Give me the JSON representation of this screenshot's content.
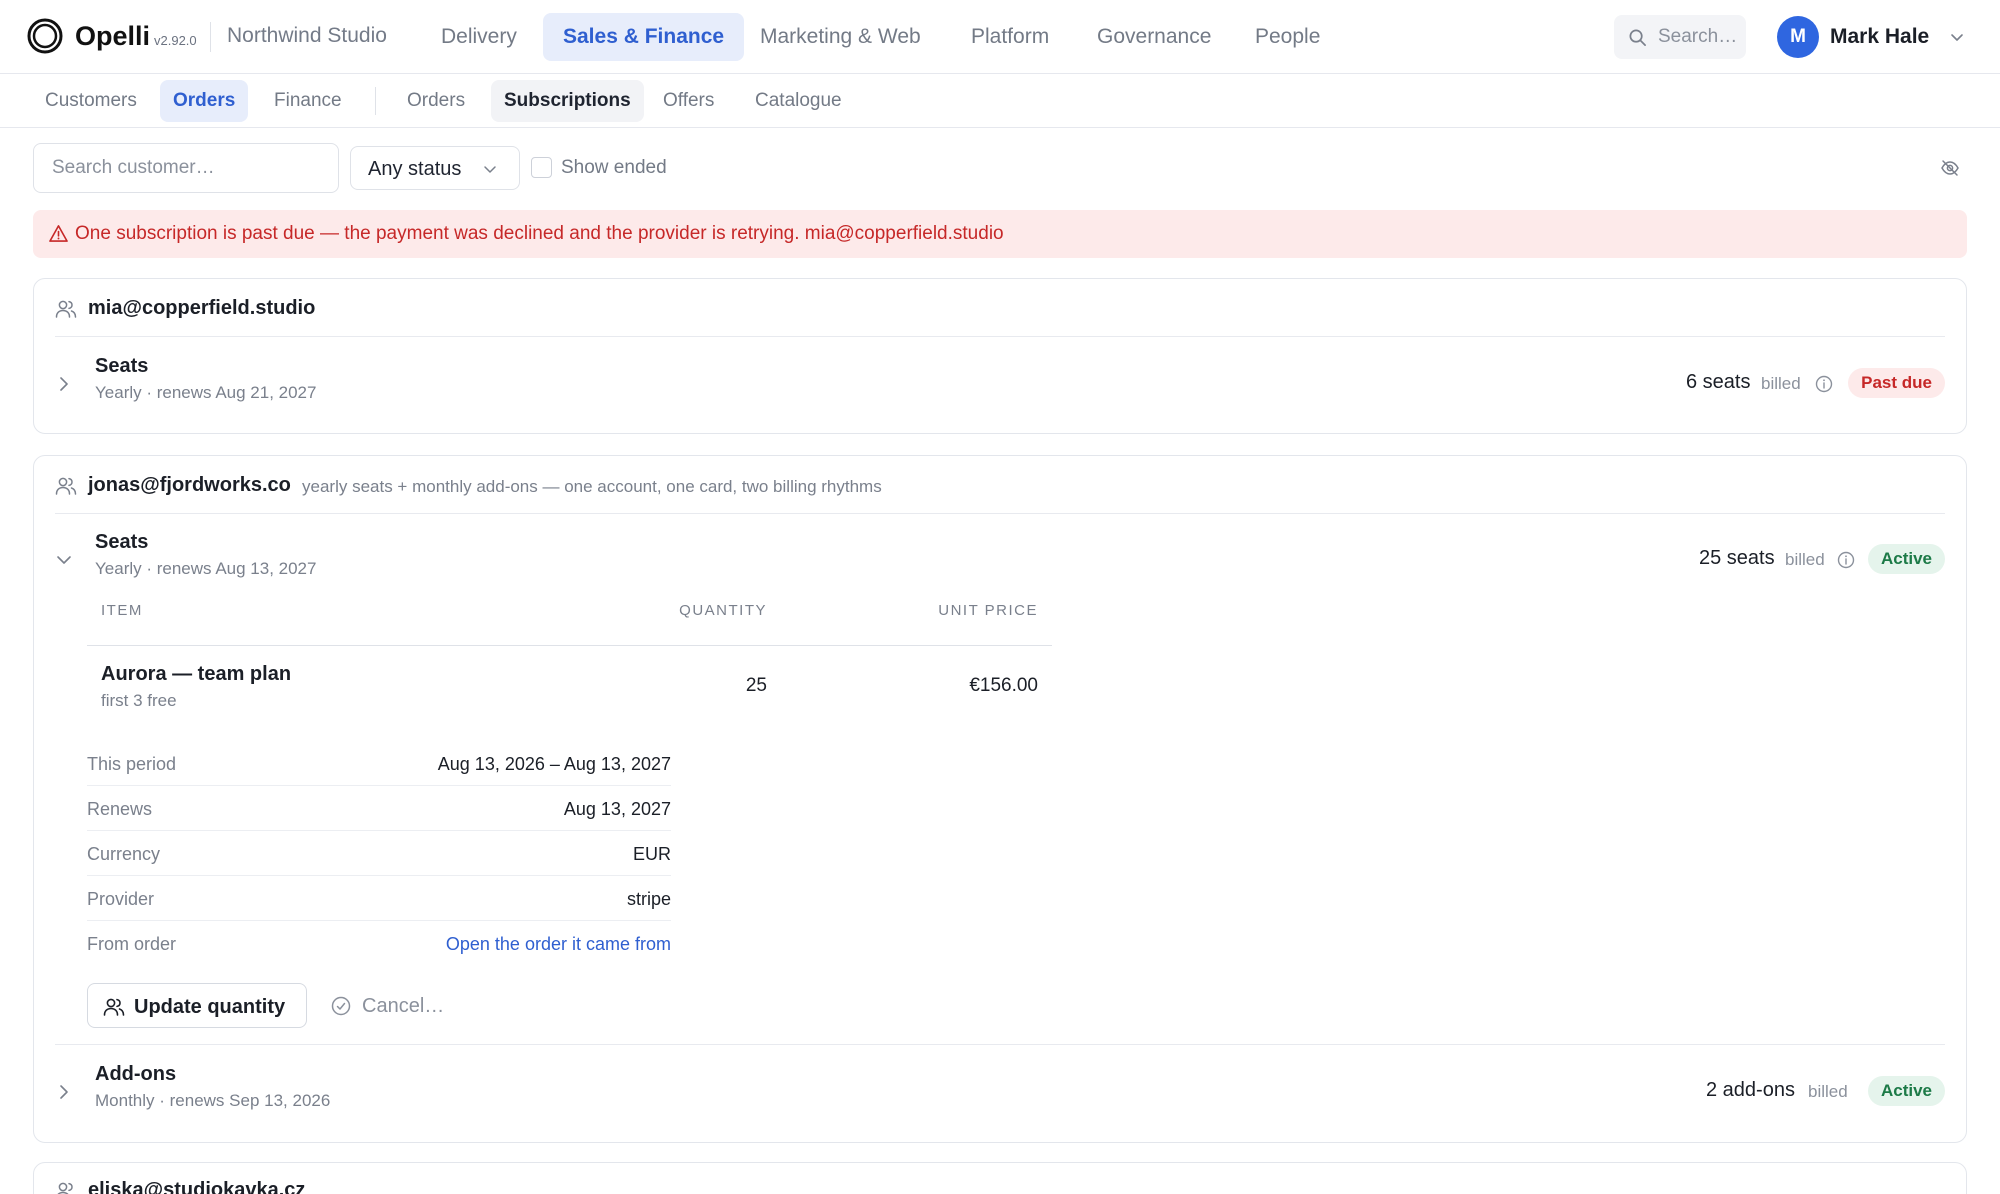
{
  "app": {
    "name": "Opelli",
    "version": "v2.92.0",
    "workspace": "Northwind Studio"
  },
  "main_nav": [
    {
      "label": "Delivery"
    },
    {
      "label": "Sales & Finance",
      "active": true
    },
    {
      "label": "Marketing & Web"
    },
    {
      "label": "Platform"
    },
    {
      "label": "Governance"
    },
    {
      "label": "People"
    }
  ],
  "top_search": {
    "placeholder": "Search…",
    "icon": "search-icon"
  },
  "user": {
    "initial": "M",
    "name": "Mark Hale"
  },
  "sub_nav": {
    "group1": [
      {
        "label": "Customers"
      },
      {
        "label": "Orders",
        "active": true
      },
      {
        "label": "Finance"
      }
    ],
    "group2": [
      {
        "label": "Orders"
      },
      {
        "label": "Subscriptions",
        "active": true
      },
      {
        "label": "Offers"
      },
      {
        "label": "Catalogue"
      }
    ]
  },
  "filters": {
    "search_placeholder": "Search customer…",
    "status_value": "Any status",
    "show_ended_label": "Show ended",
    "show_ended_checked": false
  },
  "alert": {
    "text": "One subscription is past due — the payment was declined and the provider is retrying. mia@copperfield.studio"
  },
  "customers": [
    {
      "email": "mia@copperfield.studio",
      "note": "",
      "subscriptions": [
        {
          "name": "Seats",
          "meta": "Yearly · renews Aug 21, 2027",
          "quantity": "6 seats",
          "billed": "billed",
          "status": "Past due",
          "expanded": false
        }
      ]
    },
    {
      "email": "jonas@fjordworks.co",
      "note": "yearly seats + monthly add-ons — one account, one card, two billing rhythms",
      "subscriptions": [
        {
          "name": "Seats",
          "meta": "Yearly · renews Aug 13, 2027",
          "quantity": "25 seats",
          "billed": "billed",
          "status": "Active",
          "expanded": true,
          "table_headers": {
            "item": "ITEM",
            "quantity": "QUANTITY",
            "unit_price": "UNIT PRICE"
          },
          "items": [
            {
              "name": "Aurora — team plan",
              "sub": "first 3 free",
              "quantity": "25",
              "unit_price": "€156.00"
            }
          ],
          "details": [
            {
              "label": "This period",
              "value": "Aug 13, 2026 – Aug 13, 2027"
            },
            {
              "label": "Renews",
              "value": "Aug 13, 2027"
            },
            {
              "label": "Currency",
              "value": "EUR"
            },
            {
              "label": "Provider",
              "value": "stripe"
            },
            {
              "label": "From order",
              "value": "Open the order it came from",
              "link": true
            }
          ],
          "actions": {
            "update": "Update quantity",
            "cancel": "Cancel…"
          }
        },
        {
          "name": "Add-ons",
          "meta": "Monthly · renews Sep 13, 2026",
          "quantity": "2 add-ons",
          "billed": "billed",
          "status": "Active",
          "expanded": false
        }
      ]
    },
    {
      "email": "eliska@studiokavka.cz"
    }
  ],
  "colors": {
    "accent": "#2f5fd0",
    "accent_bg": "#e7edfb",
    "danger": "#c62828",
    "danger_bg": "#fdeaea",
    "success": "#1c7a47",
    "success_bg": "#e5f4ec",
    "avatar": "#2f66e0"
  }
}
